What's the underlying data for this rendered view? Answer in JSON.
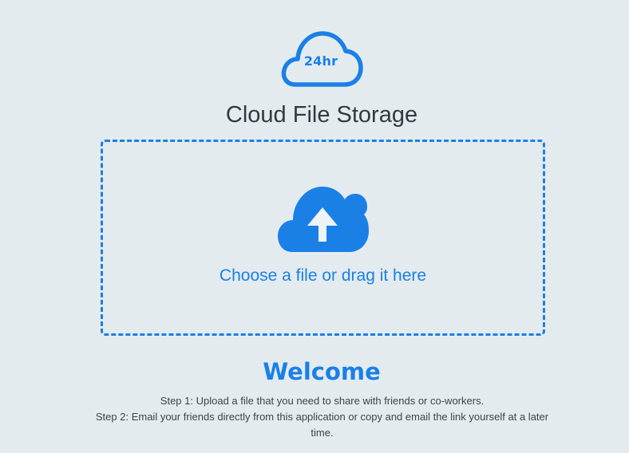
{
  "app": {
    "logo_badge": "24hr",
    "title": "Cloud File Storage"
  },
  "dropzone": {
    "label": "Choose a file or drag it here",
    "icon": "cloud-upload-icon"
  },
  "welcome": {
    "heading": "Welcome",
    "step1": "Step 1: Upload a file that you need to share with friends or co-workers.",
    "step2": "Step 2: Email your friends directly from this application or copy and email the link yourself at a later time."
  },
  "colors": {
    "accent": "#1a80e6",
    "background": "#e4ebef",
    "title_text": "#333a3f",
    "body_text": "#3d4448"
  }
}
